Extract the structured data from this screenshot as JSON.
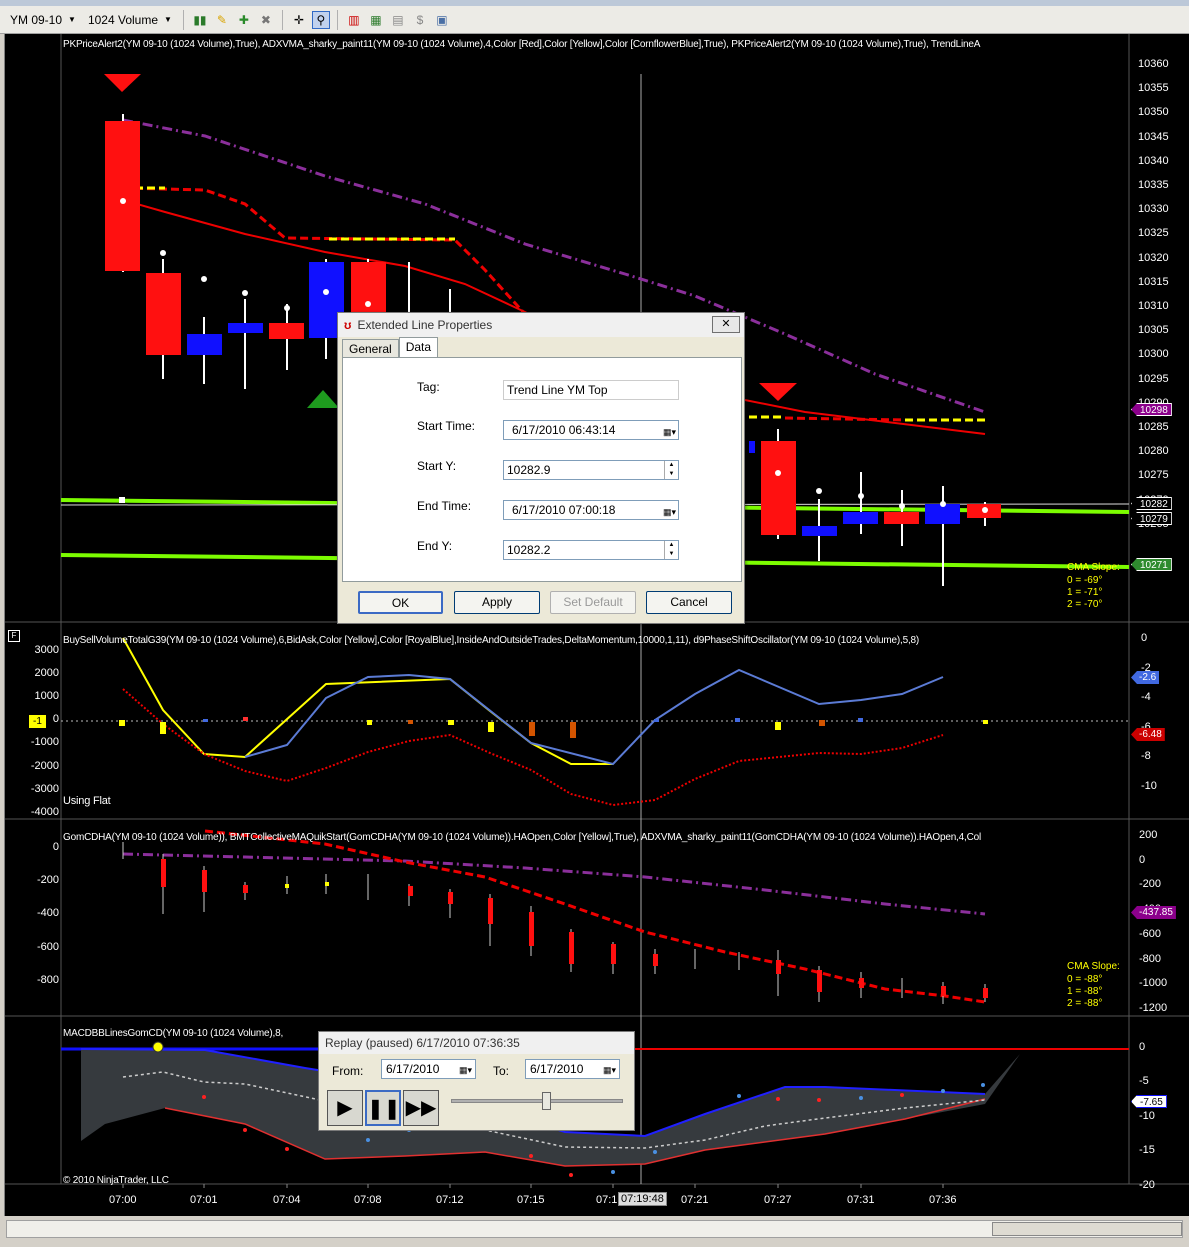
{
  "toolbar": {
    "instrument": "YM 09-10",
    "interval": "1024 Volume"
  },
  "price_panel": {
    "label": "PKPriceAlert2(YM 09-10 (1024 Volume),True), ADXVMA_sharky_paint11(YM 09-10 (1024 Volume),4,Color [Red],Color [Yellow],Color [CornflowerBlue],True), PKPriceAlert2(YM 09-10 (1024 Volume),True), TrendLineA",
    "y_ticks": [
      "10360",
      "10355",
      "10350",
      "10345",
      "10340",
      "10335",
      "10330",
      "10325",
      "10320",
      "10315",
      "10310",
      "10305",
      "10300",
      "10295",
      "10290",
      "10285",
      "10280",
      "10275",
      "10270",
      "10265"
    ],
    "tags": [
      {
        "text": "10298",
        "color": "#8b008b"
      },
      {
        "text": "10282",
        "color": "#000000"
      },
      {
        "text": "10279",
        "color": "#000000"
      },
      {
        "text": "10271",
        "color": "#2e8b2e"
      }
    ],
    "cma_title": "CMA Slope:",
    "cma_lines": [
      "0 = -69°",
      "1 = -71°",
      "2 = -70°"
    ]
  },
  "volume_panel": {
    "label": "BuySellVolumeTotalG39(YM 09-10 (1024 Volume),6,BidAsk,Color [Yellow],Color [RoyalBlue],InsideAndOutsideTrades,DeltaMomentum,10000,1,11), d9PhaseShiftOscillator(YM 09-10 (1024 Volume),5,8)",
    "left_ticks": [
      "3000",
      "2000",
      "1000",
      "0",
      "-1000",
      "-2000",
      "-3000",
      "-4000"
    ],
    "right_ticks": [
      "0",
      "-2",
      "-4",
      "-6",
      "-8",
      "-10"
    ],
    "left_tag": "-1",
    "right_tags": [
      {
        "text": "-2.6",
        "color": "#4169e1"
      },
      {
        "text": "-6.48",
        "color": "#cc0000"
      }
    ],
    "footer": "Using Flat"
  },
  "gom_panel": {
    "label": "GomCDHA(YM 09-10 (1024 Volume)), BMTCollectiveMAQuikStart(GomCDHA(YM 09-10 (1024 Volume)).HAOpen,Color [Yellow],True), ADXVMA_sharky_paint11(GomCDHA(YM 09-10 (1024 Volume)).HAOpen,4,Col",
    "left_ticks": [
      "0",
      "-200",
      "-400",
      "-600",
      "-800"
    ],
    "right_ticks": [
      "200",
      "0",
      "-200",
      "-400",
      "-600",
      "-800",
      "-1000",
      "-1200"
    ],
    "tag": "-437.85",
    "cma_title": "CMA Slope:",
    "cma_lines": [
      "0 = -88°",
      "1 = -88°",
      "2 = -88°"
    ]
  },
  "macd_panel": {
    "label": "MACDBBLinesGomCD(YM 09-10 (1024 Volume),8,",
    "right_ticks": [
      "0",
      "-5",
      "-10",
      "-15",
      "-20"
    ],
    "tag": "-7.65",
    "copyright": "© 2010 NinjaTrader, LLC"
  },
  "time_axis": {
    "ticks": [
      "07:00",
      "07:01",
      "07:04",
      "07:08",
      "07:12",
      "07:15",
      "07:1",
      "07:21",
      "07:27",
      "07:31",
      "07:36"
    ],
    "cursor_time": "07:19:48"
  },
  "dialog": {
    "title": "Extended Line Properties",
    "close": "✕",
    "tabs": [
      "General",
      "Data"
    ],
    "selected_tab": "Data",
    "fields": {
      "tag_label": "Tag:",
      "tag_value": "Trend Line YM Top",
      "start_time_label": "Start Time:",
      "start_time_value": "6/17/2010 06:43:14",
      "start_y_label": "Start Y:",
      "start_y_value": "10282.9",
      "end_time_label": "End Time:",
      "end_time_value": "6/17/2010 07:00:18",
      "end_y_label": "End Y:",
      "end_y_value": "10282.2"
    },
    "buttons": {
      "ok": "OK",
      "apply": "Apply",
      "set_default": "Set Default",
      "cancel": "Cancel"
    }
  },
  "replay": {
    "title": "Replay (paused) 6/17/2010 07:36:35",
    "from_label": "From:",
    "from_value": "6/17/2010",
    "to_label": "To:",
    "to_value": "6/17/2010",
    "slider_position": 0.55
  }
}
